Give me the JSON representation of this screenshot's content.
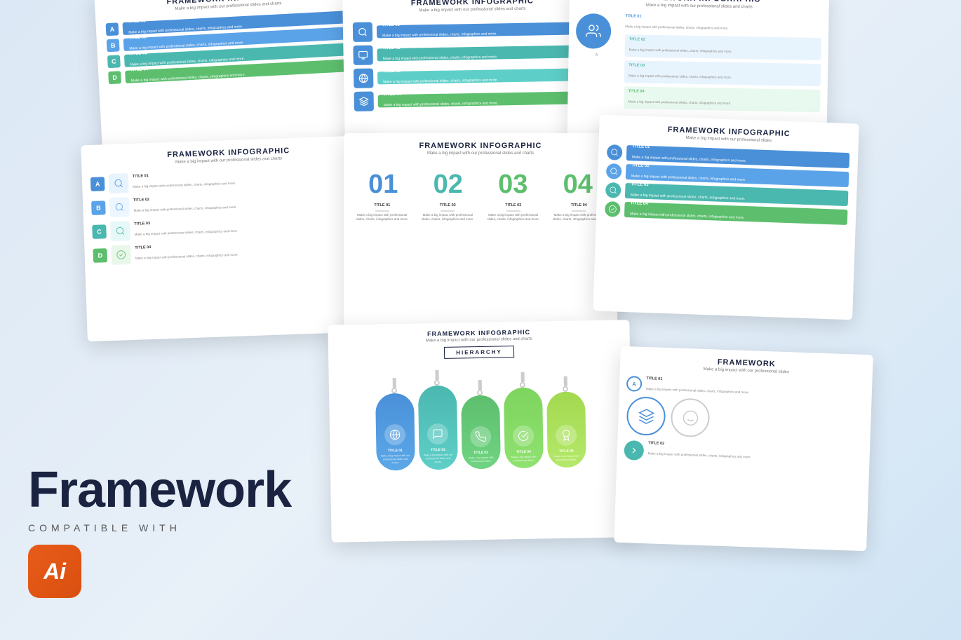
{
  "page": {
    "background": "#dce8f5",
    "title": "Framework",
    "compatible_label": "COMPATIBLE WITH",
    "ai_label": "Ai"
  },
  "slides": {
    "infographic_title": "FRAMEWORK INFOGRAPHIC",
    "infographic_subtitle": "Make a big impact with our professional slides and charts",
    "items": [
      {
        "letter": "A",
        "title": "TITLE 01",
        "text": "Make a big impact with professional slides, charts, infographics and more."
      },
      {
        "letter": "B",
        "title": "TITLE 02",
        "text": "Make a big impact with professional slides, charts, infographics and more."
      },
      {
        "letter": "C",
        "title": "TITLE 03",
        "text": "Make a big impact with professional slides, charts, infographics and more."
      },
      {
        "letter": "D",
        "title": "TITLE 04",
        "text": "Make a big impact with professional slides, charts, infographics and more."
      }
    ],
    "numbers": [
      "01",
      "02",
      "03",
      "04"
    ],
    "hierarchy_title": "HIERARCHY",
    "hierarchy_subtitle": "FRAMEWORK INFOGRAPHIC",
    "pods": [
      {
        "title": "TITLE 01",
        "text": "Make a big impact with our professional slides and charts."
      },
      {
        "title": "TITLE 02",
        "text": "Make a big impact with our professional slides and charts."
      },
      {
        "title": "TITLE 03",
        "text": "Make a big impact with professional slides."
      },
      {
        "title": "TITLE 04",
        "text": "Make a big impact with professional slides."
      },
      {
        "title": "TITLE 05",
        "text": "Make a big impact with professional slides."
      }
    ]
  }
}
